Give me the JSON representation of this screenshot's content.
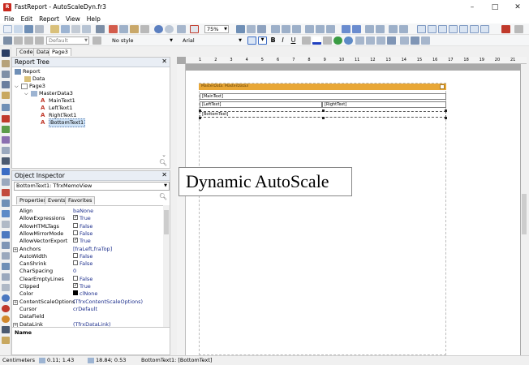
{
  "window": {
    "title": "FastReport - AutoScaleDyn.fr3",
    "app_icon": "R"
  },
  "menu": [
    "File",
    "Edit",
    "Report",
    "View",
    "Help"
  ],
  "toolbar1": {
    "zoom": "75%"
  },
  "toolbar2": {
    "style_combo": "Default",
    "style_combo2": "No style",
    "font_name": "Arial",
    "bold_label": "B",
    "italic_label": "I",
    "underline_label": "U"
  },
  "tabs": [
    "Code",
    "Data",
    "Page3"
  ],
  "report_tree": {
    "title": "Report Tree",
    "items": [
      {
        "label": "Report"
      },
      {
        "label": "Data"
      },
      {
        "label": "Page3"
      },
      {
        "label": "MasterData3"
      },
      {
        "label": "MainText1"
      },
      {
        "label": "LeftText1"
      },
      {
        "label": "RightText1"
      },
      {
        "label": "BottomText1"
      }
    ]
  },
  "object_inspector": {
    "title": "Object Inspector",
    "selected_object": "BottomText1: TfrxMemoView",
    "tabs": [
      "Properties",
      "Events",
      "Favorites"
    ],
    "properties": [
      {
        "name": "Align",
        "value": "baNone"
      },
      {
        "name": "AllowExpressions",
        "value": "True",
        "check": true
      },
      {
        "name": "AllowHTMLTags",
        "value": "False",
        "check": false
      },
      {
        "name": "AllowMirrorMode",
        "value": "False",
        "check": false
      },
      {
        "name": "AllowVectorExport",
        "value": "True",
        "check": true
      },
      {
        "name": "Anchors",
        "value": "[fraLeft,fraTop]",
        "expand": true
      },
      {
        "name": "AutoWidth",
        "value": "False",
        "check": false
      },
      {
        "name": "CanShrink",
        "value": "False",
        "check": false
      },
      {
        "name": "CharSpacing",
        "value": "0"
      },
      {
        "name": "ClearEmptyLines",
        "value": "False",
        "check": false
      },
      {
        "name": "Clipped",
        "value": "True",
        "check": true
      },
      {
        "name": "Color",
        "value": "clNone",
        "swatch": true
      },
      {
        "name": "ContentScaleOptions",
        "value": "(TfrxContentScaleOptions)",
        "expand": true
      },
      {
        "name": "Cursor",
        "value": "crDefault"
      },
      {
        "name": "DataField",
        "value": ""
      },
      {
        "name": "DataLink",
        "value": "(TfrxDataLink)",
        "expand": true
      }
    ],
    "name_pane_label": "Name"
  },
  "design": {
    "band_label": "MasterData: MasterData3",
    "memos": {
      "main": "[MainText]",
      "left": "[LeftText]",
      "right": "[RightText]",
      "bottom": "[BottomText]"
    },
    "ruler_numbers": [
      "1",
      "2",
      "3",
      "4",
      "5",
      "6",
      "7",
      "8",
      "9",
      "10",
      "11",
      "12",
      "13",
      "14",
      "15",
      "16",
      "17",
      "18",
      "19",
      "20",
      "21"
    ]
  },
  "overlay_label": "Dynamic AutoScale",
  "status": {
    "units": "Centimeters",
    "position": "0.11; 1.43",
    "size": "18.84; 0.53",
    "selected": "BottomText1: [BottomText]"
  },
  "colors": {
    "band": "#e8a737",
    "accent": "#1c2e8c"
  }
}
